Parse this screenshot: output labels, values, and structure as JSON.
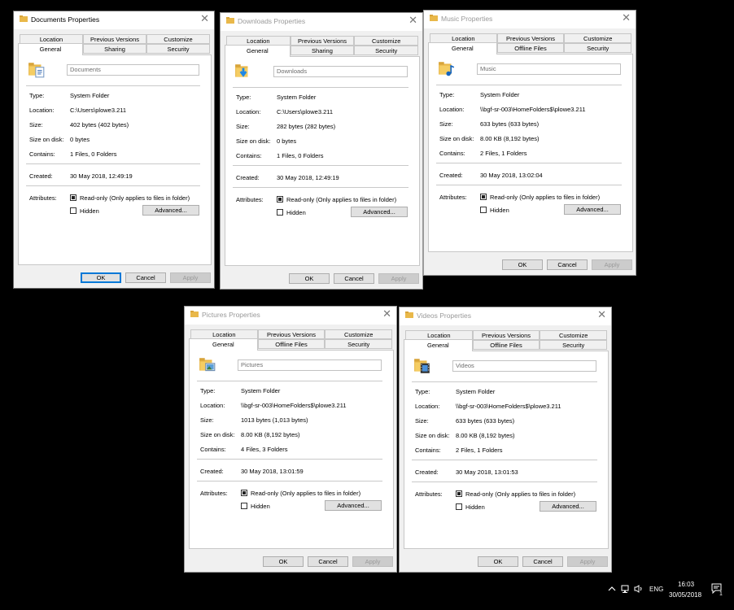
{
  "common": {
    "tabs_top": [
      "Location",
      "Previous Versions",
      "Customize"
    ],
    "general_tab": "General",
    "labels": {
      "type": "Type:",
      "location": "Location:",
      "size": "Size:",
      "size_on_disk": "Size on disk:",
      "contains": "Contains:",
      "created": "Created:",
      "attributes": "Attributes:"
    },
    "readonly_label": "Read-only (Only applies to files in folder)",
    "hidden_label": "Hidden",
    "advanced_label": "Advanced...",
    "ok_label": "OK",
    "cancel_label": "Cancel",
    "apply_label": "Apply"
  },
  "dialogs": [
    {
      "title": "Documents Properties",
      "icon": "documents-folder-icon",
      "tab_mid": "Sharing",
      "tab_right": "Security",
      "name": "Documents",
      "type": "System Folder",
      "location": "C:\\Users\\plowe3.211",
      "size": "402 bytes (402 bytes)",
      "size_on_disk": "0 bytes",
      "contains": "1 Files, 0 Folders",
      "created": "30 May 2018, 12:49:19",
      "readonly": true,
      "hidden": false
    },
    {
      "title": "Downloads Properties",
      "icon": "downloads-folder-icon",
      "tab_mid": "Sharing",
      "tab_right": "Security",
      "name": "Downloads",
      "type": "System Folder",
      "location": "C:\\Users\\plowe3.211",
      "size": "282 bytes (282 bytes)",
      "size_on_disk": "0 bytes",
      "contains": "1 Files, 0 Folders",
      "created": "30 May 2018, 12:49:19",
      "readonly": true,
      "hidden": false
    },
    {
      "title": "Music Properties",
      "icon": "music-folder-icon",
      "tab_mid": "Offline Files",
      "tab_right": "Security",
      "name": "Music",
      "type": "System Folder",
      "location": "\\\\bgf-sr-003\\HomeFolders$\\plowe3.211",
      "size": "633 bytes (633 bytes)",
      "size_on_disk": "8.00 KB (8,192 bytes)",
      "contains": "2 Files, 1 Folders",
      "created": "30 May 2018, 13:02:04",
      "readonly": true,
      "hidden": false
    },
    {
      "title": "Pictures Properties",
      "icon": "pictures-folder-icon",
      "tab_mid": "Offline Files",
      "tab_right": "Security",
      "name": "Pictures",
      "type": "System Folder",
      "location": "\\\\bgf-sr-003\\HomeFolders$\\plowe3.211",
      "size": "1013 bytes (1,013 bytes)",
      "size_on_disk": "8.00 KB (8,192 bytes)",
      "contains": "4 Files, 3 Folders",
      "created": "30 May 2018, 13:01:59",
      "readonly": true,
      "hidden": false
    },
    {
      "title": "Videos Properties",
      "icon": "videos-folder-icon",
      "tab_mid": "Offline Files",
      "tab_right": "Security",
      "name": "Videos",
      "type": "System Folder",
      "location": "\\\\bgf-sr-003\\HomeFolders$\\plowe3.211",
      "size": "633 bytes (633 bytes)",
      "size_on_disk": "8.00 KB (8,192 bytes)",
      "contains": "2 Files, 1 Folders",
      "created": "30 May 2018, 13:01:53",
      "readonly": true,
      "hidden": false
    }
  ],
  "taskbar": {
    "language": "ENG",
    "time": "16:03",
    "date": "30/05/2018",
    "notification_count": "1",
    "icons": [
      "chevron-up-icon",
      "network-icon",
      "speaker-icon",
      "action-center-icon"
    ]
  }
}
